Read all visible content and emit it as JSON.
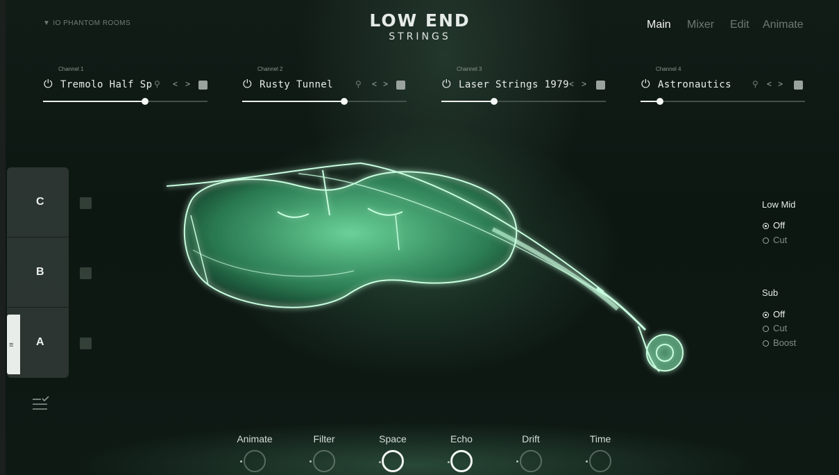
{
  "header": {
    "brand": "IO PHANTOM ROOMS",
    "logo_line1": "LOW END",
    "logo_line2": "STRINGS",
    "nav": [
      "Main",
      "Mixer",
      "Edit",
      "Animate"
    ],
    "active_nav": "Main"
  },
  "channels": [
    {
      "caption": "Channel 1",
      "name": "Tremolo Half Sp",
      "level": 0.62
    },
    {
      "caption": "Channel 2",
      "name": "Rusty Tunnel",
      "level": 0.62
    },
    {
      "caption": "Channel 3",
      "name": "Laser Strings 1979",
      "level": 0.32
    },
    {
      "caption": "Channel 4",
      "name": "Astronautics",
      "level": 0.12
    }
  ],
  "tabs": [
    {
      "label": "C"
    },
    {
      "label": "B"
    },
    {
      "label": "A",
      "selected": true
    }
  ],
  "eq": {
    "low_mid": {
      "title": "Low Mid",
      "options": [
        "Off",
        "Cut"
      ],
      "selected": "Off"
    },
    "sub": {
      "title": "Sub",
      "options": [
        "Off",
        "Cut",
        "Boost"
      ],
      "selected": "Off"
    }
  },
  "knobs": [
    {
      "label": "Animate",
      "active": false
    },
    {
      "label": "Filter",
      "active": false
    },
    {
      "label": "Space",
      "active": true
    },
    {
      "label": "Echo",
      "active": true
    },
    {
      "label": "Drift",
      "active": false
    },
    {
      "label": "Time",
      "active": false
    }
  ],
  "icons": {
    "power": "power-icon",
    "search": "search-icon",
    "prev": "chevron-left-icon",
    "next": "chevron-right-icon",
    "random": "dice-icon",
    "menu": "menu-icon",
    "tasklist": "checklist-icon"
  },
  "colors": {
    "glow": "#8df2b4",
    "accent_white": "#f2f6f3",
    "background": "#0c130f"
  }
}
